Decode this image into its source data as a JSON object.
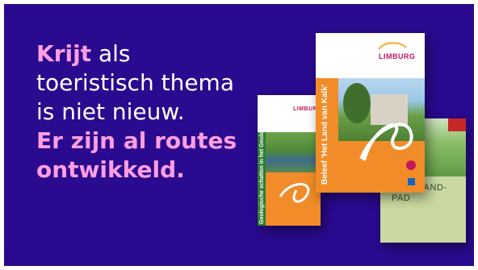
{
  "headline": {
    "line1_emphasis": "Krijt",
    "line1_rest": " als",
    "line2": "toeristisch thema",
    "line3": "is niet nieuw.",
    "line4": "Er zijn al routes",
    "line5": "ontwikkeld."
  },
  "brochures": {
    "left_spine": "Geologische schatten in het Geuldal",
    "middle_spine": "Beleef 'Het Land van Kalk'",
    "right_title_line1": "KRIJTLAND-",
    "right_title_line2": "PAD",
    "logo_text": "LIMBURG"
  },
  "colors": {
    "background": "#2a0a8f",
    "accent_pink": "#ff9ee0",
    "brochure_orange": "#f28c28"
  }
}
